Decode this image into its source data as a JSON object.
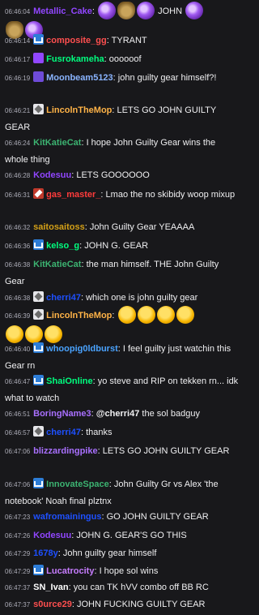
{
  "messages": [
    {
      "ts": "06:46:04",
      "badge": "",
      "user": "Metallic_Cake",
      "color": "#9146ff",
      "sep": ":",
      "text": "",
      "emotes": [
        "purple-swirl-emote",
        "pot-emote",
        "purple-swirl-emote"
      ],
      "text2": "JOHN",
      "emotes2": [
        "purple-swirl-emote",
        "pot-emote",
        "purple-swirl-emote"
      ]
    },
    {
      "ts": "06:46:14",
      "badge": "sub",
      "user": "composite_gg",
      "color": "#ff4f4f",
      "sep": ":",
      "text": "TYRANT"
    },
    {
      "ts": "06:46:17",
      "badge": "prime",
      "user": "Fusrokameha",
      "color": "#00ff7f",
      "sep": ":",
      "text": "oooooof"
    },
    {
      "ts": "06:46:19",
      "badge": "star",
      "user": "Moonbeam5123",
      "color": "#8ab4ff",
      "sep": ":",
      "text": "john guilty gear himself?!"
    },
    {
      "ts": "06:46:21",
      "badge": "bits",
      "user": "LincolnTheMop",
      "color": "#ffb347",
      "sep": ":",
      "text": "LETS GO JOHN GUILTY GEAR"
    },
    {
      "ts": "06:46:24",
      "badge": "",
      "user": "KitKatieCat",
      "color": "#3cb371",
      "sep": ":",
      "text": "I hope John Guilty Gear wins the whole thing"
    },
    {
      "ts": "06:46:28",
      "badge": "",
      "user": "Kodesuu",
      "color": "#9146ff",
      "sep": ":",
      "text": "LETS GOOOOOO"
    },
    {
      "ts": "06:46:31",
      "badge": "mod",
      "user": "gas_master_",
      "color": "#ff3b3b",
      "sep": ":",
      "text": "Lmao the no skibidy woop mixup"
    },
    {
      "ts": "06:46:32",
      "badge": "",
      "user": "saitosaitoss",
      "color": "#d4a017",
      "sep": ":",
      "text": "John Guilty Gear YEAAAA"
    },
    {
      "ts": "06:46:36",
      "badge": "sub",
      "user": "kelso_g",
      "color": "#00ff7f",
      "sep": ":",
      "text": "JOHN G. GEAR"
    },
    {
      "ts": "06:46:38",
      "badge": "",
      "user": "KitKatieCat",
      "color": "#3cb371",
      "sep": ":",
      "text": "the man himself. THE John Guilty Gear"
    },
    {
      "ts": "06:46:38",
      "badge": "bits",
      "user": "cherri47",
      "color": "#1e50ff",
      "sep": ":",
      "text": "which one is john guilty gear"
    },
    {
      "ts": "06:46:39",
      "badge": "bits",
      "user": "LincolnTheMop",
      "color": "#ffb347",
      "sep": ":",
      "text": "",
      "emotes": [
        "wario-emote",
        "wario-emote",
        "wario-emote",
        "wario-emote",
        "wario-emote",
        "wario-emote",
        "wario-emote"
      ]
    },
    {
      "ts": "06:46:40",
      "badge": "sub",
      "user": "whoopig0ldburst",
      "color": "#4aa3ff",
      "sep": ":",
      "text": "I feel guilty just watchin this Gear rn"
    },
    {
      "ts": "06:46:47",
      "badge": "sub",
      "user": "ShaiOnline",
      "color": "#00ff7f",
      "sep": ":",
      "text": "yo steve and RIP on tekken rn... idk what to watch"
    },
    {
      "ts": "06:46:51",
      "badge": "",
      "user": "BoringName3",
      "color": "#a970ff",
      "sep": ":",
      "mention": "@cherri47",
      "text": "the sol badguy"
    },
    {
      "ts": "06:46:57",
      "badge": "bits",
      "user": "cherri47",
      "color": "#1e50ff",
      "sep": ":",
      "text": "thanks"
    },
    {
      "ts": "06:47:06",
      "badge": "",
      "user": "blizzardingpike",
      "color": "#a970ff",
      "sep": ":",
      "text": "LETS GO JOHN GUILTY GEAR"
    },
    {
      "ts": "06:47:06",
      "badge": "sub",
      "user": "InnovateSpace",
      "color": "#3cb371",
      "sep": ":",
      "text": "John Guilty Gr vs Alex 'the notebook' Noah final plztnx"
    },
    {
      "ts": "06:47:23",
      "badge": "",
      "user": "wafromainingus",
      "color": "#1e50ff",
      "sep": ":",
      "text": "GO JOHN GUILTY GEAR"
    },
    {
      "ts": "06:47:26",
      "badge": "",
      "user": "Kodesuu",
      "color": "#9146ff",
      "sep": ":",
      "text": "JOHN G. GEAR'S GO THIS"
    },
    {
      "ts": "06:47:29",
      "badge": "",
      "user": "1678y",
      "color": "#1e50ff",
      "sep": ":",
      "text": "John guilty gear himself"
    },
    {
      "ts": "06:47:29",
      "badge": "sub",
      "user": "Lucatrocity",
      "color": "#c77dff",
      "sep": ":",
      "text": "I hope sol wins"
    },
    {
      "ts": "06:47:37",
      "badge": "",
      "user": "SN_Ivan",
      "color": "#ffffff",
      "sep": ":",
      "text": "you can TK hVV combo off BB RC"
    },
    {
      "ts": "06:47:37",
      "badge": "",
      "user": "s0urce29",
      "color": "#ff4f4f",
      "sep": ":",
      "text": "JOHN FUCKING GUILTY GEAR"
    }
  ]
}
